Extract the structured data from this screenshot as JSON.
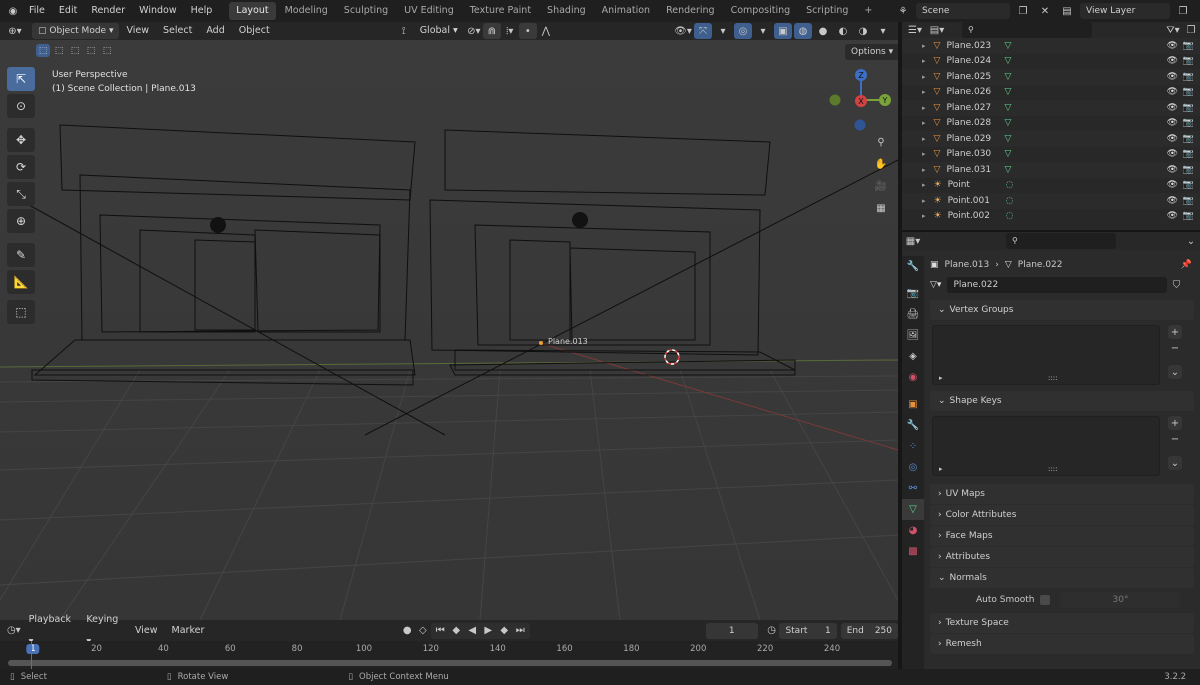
{
  "menu": {
    "file": "File",
    "edit": "Edit",
    "render": "Render",
    "window": "Window",
    "help": "Help"
  },
  "workspaces": [
    "Layout",
    "Modeling",
    "Sculpting",
    "UV Editing",
    "Texture Paint",
    "Shading",
    "Animation",
    "Rendering",
    "Compositing",
    "Scripting"
  ],
  "scene": {
    "name": "Scene",
    "view_layer": "View Layer"
  },
  "viewport_header": {
    "mode": "Object Mode",
    "view": "View",
    "select": "Select",
    "add": "Add",
    "object": "Object",
    "orientation": "Global",
    "options": "Options"
  },
  "viewport_overlay": {
    "perspective": "User Perspective",
    "collection": "(1) Scene Collection | Plane.013",
    "object_label": "Plane.013"
  },
  "gizmo": {
    "x": "X",
    "y": "Y",
    "z": "Z"
  },
  "outliner": {
    "search_placeholder": "",
    "items": [
      {
        "name": "Plane.023",
        "type": "mesh"
      },
      {
        "name": "Plane.024",
        "type": "mesh"
      },
      {
        "name": "Plane.025",
        "type": "mesh"
      },
      {
        "name": "Plane.026",
        "type": "mesh"
      },
      {
        "name": "Plane.027",
        "type": "mesh"
      },
      {
        "name": "Plane.028",
        "type": "mesh"
      },
      {
        "name": "Plane.029",
        "type": "mesh"
      },
      {
        "name": "Plane.030",
        "type": "mesh"
      },
      {
        "name": "Plane.031",
        "type": "mesh"
      },
      {
        "name": "Point",
        "type": "light"
      },
      {
        "name": "Point.001",
        "type": "light"
      },
      {
        "name": "Point.002",
        "type": "light"
      }
    ]
  },
  "properties": {
    "breadcrumb_object": "Plane.013",
    "breadcrumb_data": "Plane.022",
    "data_name": "Plane.022",
    "panels": {
      "vertex_groups": "Vertex Groups",
      "shape_keys": "Shape Keys",
      "uv_maps": "UV Maps",
      "color_attributes": "Color Attributes",
      "face_maps": "Face Maps",
      "attributes": "Attributes",
      "normals": "Normals",
      "auto_smooth": "Auto Smooth",
      "auto_smooth_angle": "30°",
      "texture_space": "Texture Space",
      "remesh": "Remesh"
    }
  },
  "timeline": {
    "playback": "Playback",
    "keying": "Keying",
    "view": "View",
    "marker": "Marker",
    "current_frame": "1",
    "start_label": "Start",
    "start": "1",
    "end_label": "End",
    "end": "250",
    "ticks": [
      "1",
      "20",
      "40",
      "60",
      "80",
      "100",
      "120",
      "140",
      "160",
      "180",
      "200",
      "220",
      "240"
    ]
  },
  "status": {
    "select": "Select",
    "rotate": "Rotate View",
    "context": "Object Context Menu",
    "version": "3.2.2"
  },
  "colors": {
    "accent": "#4a72b8",
    "mesh_icon": "#e8913c",
    "data_icon": "#5fd38c",
    "light_icon": "#f0b060"
  }
}
